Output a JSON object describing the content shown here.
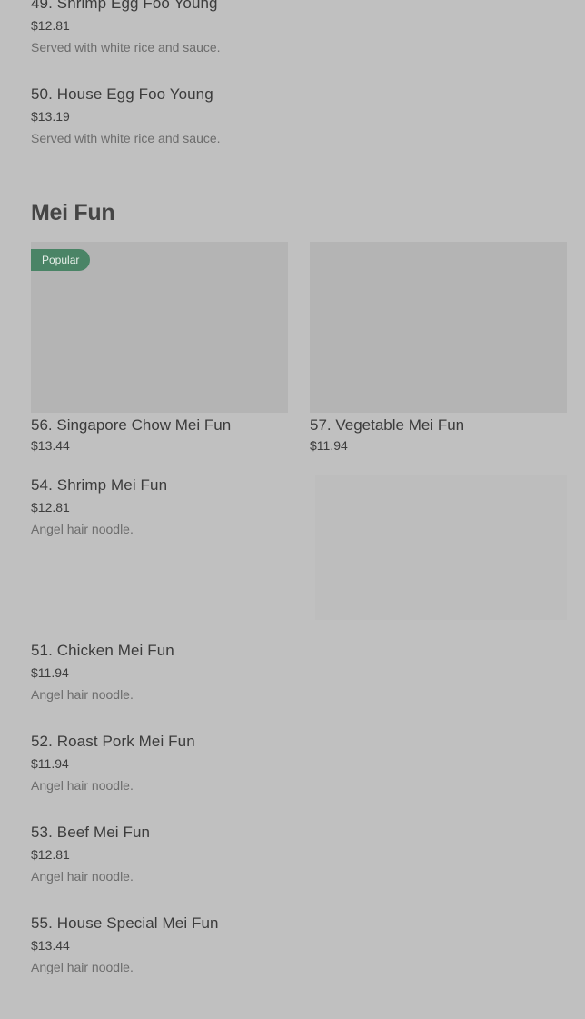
{
  "top_items": [
    {
      "name": "49. Shrimp Egg Foo Young",
      "price": "$12.81",
      "desc": "Served with white rice and sauce."
    },
    {
      "name": "50. House Egg Foo Young",
      "price": "$13.19",
      "desc": "Served with white rice and sauce."
    }
  ],
  "section": {
    "title": "Mei Fun"
  },
  "featured": [
    {
      "name": "56. Singapore Chow Mei Fun",
      "price": "$13.44",
      "badge": "Popular"
    },
    {
      "name": "57. Vegetable Mei Fun",
      "price": "$11.94"
    }
  ],
  "items": [
    {
      "name": "54. Shrimp Mei Fun",
      "price": "$12.81",
      "desc": "Angel hair noodle."
    },
    {
      "name": "51. Chicken Mei Fun",
      "price": "$11.94",
      "desc": "Angel hair noodle."
    },
    {
      "name": "52. Roast Pork Mei Fun",
      "price": "$11.94",
      "desc": "Angel hair noodle."
    },
    {
      "name": "53. Beef Mei Fun",
      "price": "$12.81",
      "desc": "Angel hair noodle."
    },
    {
      "name": "55. House Special Mei Fun",
      "price": "$13.44",
      "desc": "Angel hair noodle."
    }
  ]
}
